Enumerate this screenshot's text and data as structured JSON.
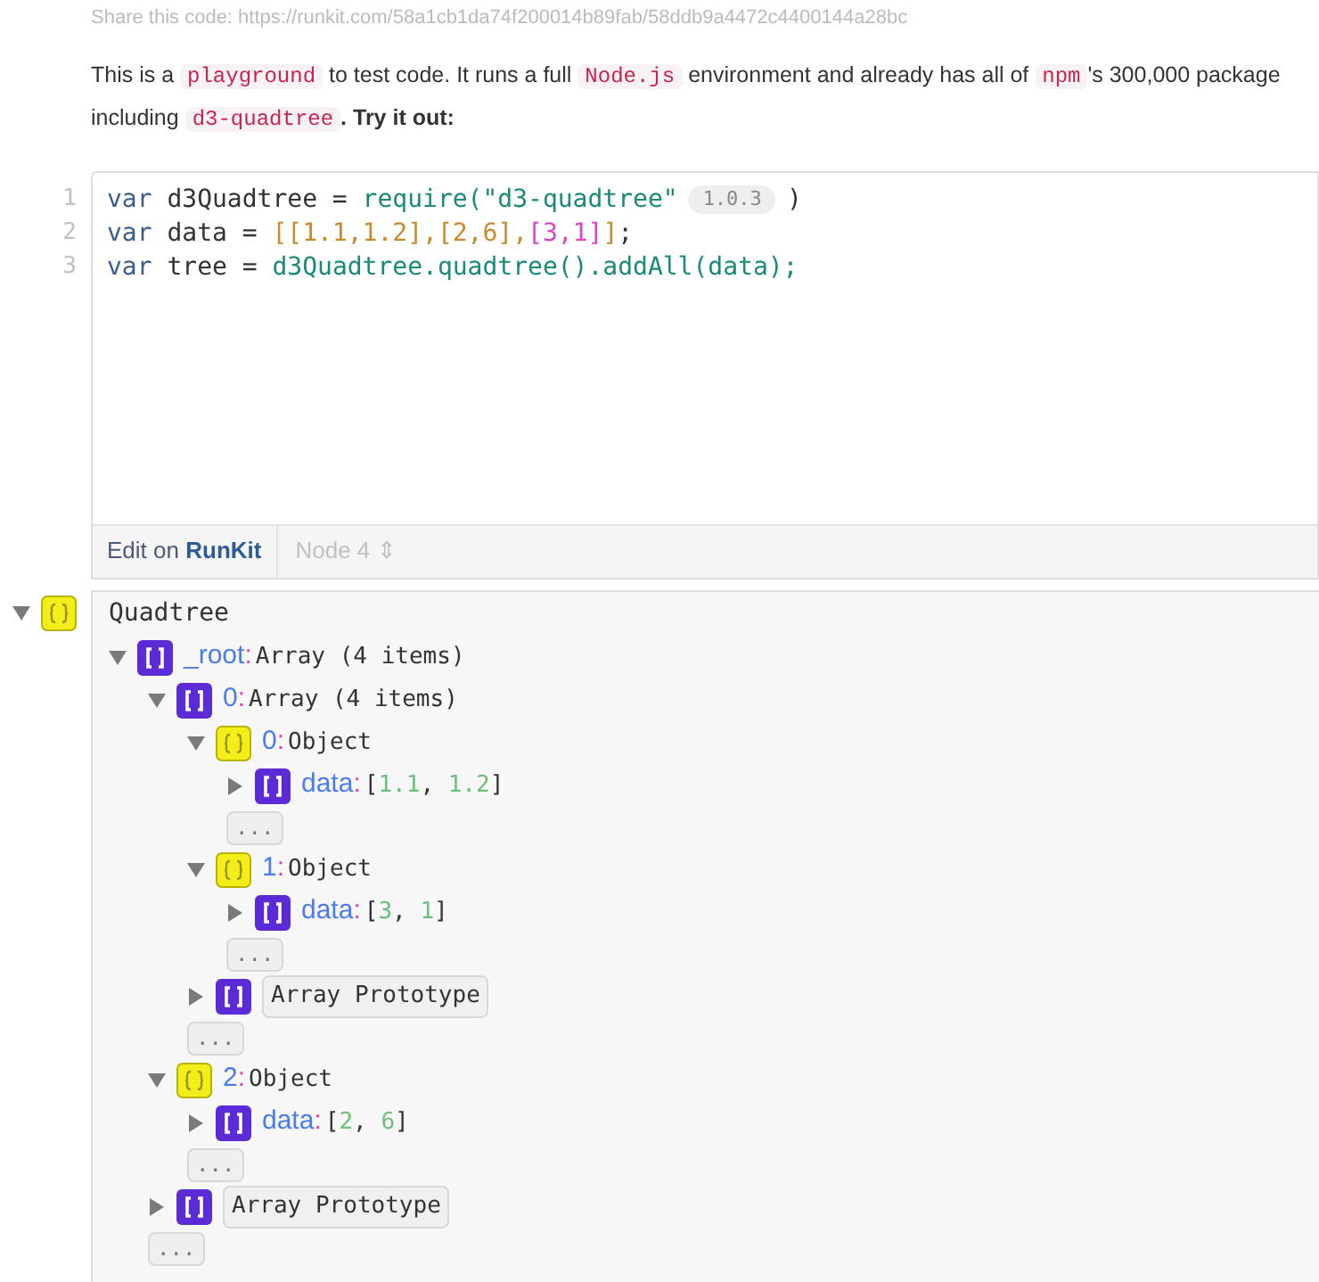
{
  "share_line": "Share this code: https://runkit.com/58a1cb1da74f200014b89fab/58ddb9a4472c4400144a28bc",
  "intro": [
    {
      "kind": "text",
      "text": "This is a "
    },
    {
      "kind": "code",
      "text": "playground"
    },
    {
      "kind": "text",
      "text": " to test code. It runs a full "
    },
    {
      "kind": "code",
      "text": "Node.js"
    },
    {
      "kind": "text",
      "text": " environment and already has all of "
    },
    {
      "kind": "code",
      "text": "npm"
    },
    {
      "kind": "text",
      "text": "'s 300,000 package"
    },
    {
      "kind": "break"
    },
    {
      "kind": "text",
      "text": "including "
    },
    {
      "kind": "code",
      "text": "d3-quadtree"
    },
    {
      "kind": "strong",
      "text": ". Try it out:"
    }
  ],
  "code_lines": [
    {
      "number": "1",
      "tokens": [
        {
          "kind": "keyword",
          "text": "var "
        },
        {
          "kind": "plain",
          "text": "d3Quadtree = "
        },
        {
          "kind": "call",
          "text": "require(\"d3-quadtree\""
        },
        {
          "kind": "version",
          "text": "1.0.3"
        },
        {
          "kind": "plain",
          "text": ")"
        }
      ]
    },
    {
      "number": "2",
      "tokens": [
        {
          "kind": "keyword",
          "text": "var "
        },
        {
          "kind": "plain",
          "text": "data = "
        },
        {
          "kind": "bracket",
          "text": "[[1.1,1.2],[2,6],"
        },
        {
          "kind": "bracket2",
          "text": "[3,1]"
        },
        {
          "kind": "bracket",
          "text": "]"
        },
        {
          "kind": "plain",
          "text": ";"
        }
      ]
    },
    {
      "number": "3",
      "tokens": [
        {
          "kind": "keyword",
          "text": "var "
        },
        {
          "kind": "plain",
          "text": "tree = "
        },
        {
          "kind": "call",
          "text": "d3Quadtree.quadtree().addAll(data);"
        }
      ]
    }
  ],
  "footer": {
    "edit_label": "Edit on",
    "edit_brand": "RunKit",
    "runtime": "Node 4",
    "runtime_icon": "⇕"
  },
  "output": {
    "kind": "object",
    "label": "Quadtree",
    "expanded": true,
    "children": [
      {
        "kind": "array",
        "key": "_root",
        "colon": ":",
        "label": "Array (4 items)",
        "expanded": true,
        "children": [
          {
            "kind": "array",
            "key": "0",
            "colon": ":",
            "label": "Array (4 items)",
            "expanded": true,
            "children": [
              {
                "kind": "object",
                "key": "0",
                "colon": ":",
                "label": "Object",
                "expanded": true,
                "children": [
                  {
                    "kind": "array",
                    "key": "data",
                    "colon": ":",
                    "value": [
                      {
                        "kind": "punct",
                        "text": "["
                      },
                      {
                        "kind": "number",
                        "text": "1.1"
                      },
                      {
                        "kind": "punct",
                        "text": ", "
                      },
                      {
                        "kind": "number",
                        "text": "1.2"
                      },
                      {
                        "kind": "punct",
                        "text": "]"
                      }
                    ],
                    "expanded": false
                  },
                  {
                    "kind": "more",
                    "text": "..."
                  }
                ]
              },
              {
                "kind": "object",
                "key": "1",
                "colon": ":",
                "label": "Object",
                "expanded": true,
                "children": [
                  {
                    "kind": "array",
                    "key": "data",
                    "colon": ":",
                    "value": [
                      {
                        "kind": "punct",
                        "text": "["
                      },
                      {
                        "kind": "number",
                        "text": "3"
                      },
                      {
                        "kind": "punct",
                        "text": ", "
                      },
                      {
                        "kind": "number",
                        "text": "1"
                      },
                      {
                        "kind": "punct",
                        "text": "]"
                      }
                    ],
                    "expanded": false
                  },
                  {
                    "kind": "more",
                    "text": "..."
                  }
                ]
              },
              {
                "kind": "prototype",
                "label": "Array Prototype",
                "expanded": false
              },
              {
                "kind": "more",
                "text": "..."
              }
            ]
          },
          {
            "kind": "object",
            "key": "2",
            "colon": ":",
            "label": "Object",
            "expanded": true,
            "children": [
              {
                "kind": "array",
                "key": "data",
                "colon": ":",
                "value": [
                  {
                    "kind": "punct",
                    "text": "["
                  },
                  {
                    "kind": "number",
                    "text": "2"
                  },
                  {
                    "kind": "punct",
                    "text": ", "
                  },
                  {
                    "kind": "number",
                    "text": "6"
                  },
                  {
                    "kind": "punct",
                    "text": "]"
                  }
                ],
                "expanded": false
              },
              {
                "kind": "more",
                "text": "..."
              }
            ]
          },
          {
            "kind": "prototype",
            "label": "Array Prototype",
            "expanded": false
          },
          {
            "kind": "more",
            "text": "..."
          }
        ]
      }
    ]
  }
}
